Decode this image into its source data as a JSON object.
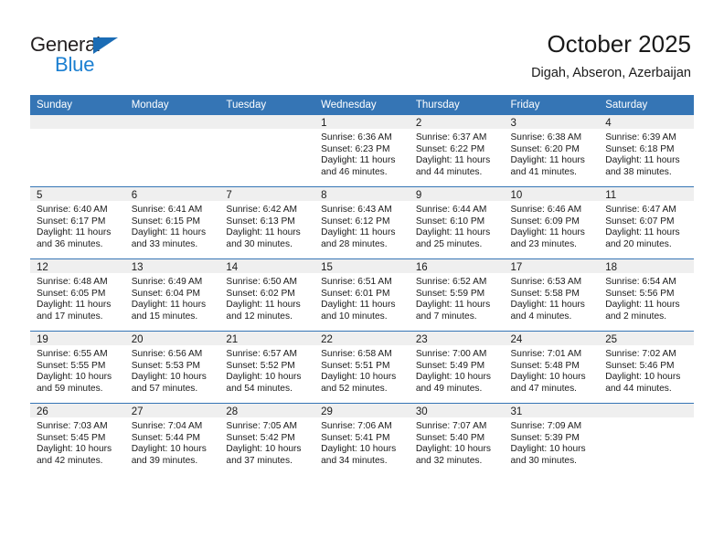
{
  "brand": {
    "name_line1": "General",
    "name_line2": "Blue",
    "triangle_icon": "blue-triangle-icon",
    "color_dark": "#231f20",
    "color_blue": "#1b7fd1",
    "accent": "#3575b5"
  },
  "header": {
    "title": "October 2025",
    "subtitle": "Digah, Abseron, Azerbaijan"
  },
  "weekday_headers": [
    "Sunday",
    "Monday",
    "Tuesday",
    "Wednesday",
    "Thursday",
    "Friday",
    "Saturday"
  ],
  "weeks": [
    [
      {
        "day": "",
        "sunrise": "",
        "sunset": "",
        "daylight_line1": "",
        "daylight_line2": "",
        "empty": true
      },
      {
        "day": "",
        "sunrise": "",
        "sunset": "",
        "daylight_line1": "",
        "daylight_line2": "",
        "empty": true
      },
      {
        "day": "",
        "sunrise": "",
        "sunset": "",
        "daylight_line1": "",
        "daylight_line2": "",
        "empty": true
      },
      {
        "day": "1",
        "sunrise": "Sunrise: 6:36 AM",
        "sunset": "Sunset: 6:23 PM",
        "daylight_line1": "Daylight: 11 hours",
        "daylight_line2": "and 46 minutes.",
        "empty": false
      },
      {
        "day": "2",
        "sunrise": "Sunrise: 6:37 AM",
        "sunset": "Sunset: 6:22 PM",
        "daylight_line1": "Daylight: 11 hours",
        "daylight_line2": "and 44 minutes.",
        "empty": false
      },
      {
        "day": "3",
        "sunrise": "Sunrise: 6:38 AM",
        "sunset": "Sunset: 6:20 PM",
        "daylight_line1": "Daylight: 11 hours",
        "daylight_line2": "and 41 minutes.",
        "empty": false
      },
      {
        "day": "4",
        "sunrise": "Sunrise: 6:39 AM",
        "sunset": "Sunset: 6:18 PM",
        "daylight_line1": "Daylight: 11 hours",
        "daylight_line2": "and 38 minutes.",
        "empty": false
      }
    ],
    [
      {
        "day": "5",
        "sunrise": "Sunrise: 6:40 AM",
        "sunset": "Sunset: 6:17 PM",
        "daylight_line1": "Daylight: 11 hours",
        "daylight_line2": "and 36 minutes.",
        "empty": false
      },
      {
        "day": "6",
        "sunrise": "Sunrise: 6:41 AM",
        "sunset": "Sunset: 6:15 PM",
        "daylight_line1": "Daylight: 11 hours",
        "daylight_line2": "and 33 minutes.",
        "empty": false
      },
      {
        "day": "7",
        "sunrise": "Sunrise: 6:42 AM",
        "sunset": "Sunset: 6:13 PM",
        "daylight_line1": "Daylight: 11 hours",
        "daylight_line2": "and 30 minutes.",
        "empty": false
      },
      {
        "day": "8",
        "sunrise": "Sunrise: 6:43 AM",
        "sunset": "Sunset: 6:12 PM",
        "daylight_line1": "Daylight: 11 hours",
        "daylight_line2": "and 28 minutes.",
        "empty": false
      },
      {
        "day": "9",
        "sunrise": "Sunrise: 6:44 AM",
        "sunset": "Sunset: 6:10 PM",
        "daylight_line1": "Daylight: 11 hours",
        "daylight_line2": "and 25 minutes.",
        "empty": false
      },
      {
        "day": "10",
        "sunrise": "Sunrise: 6:46 AM",
        "sunset": "Sunset: 6:09 PM",
        "daylight_line1": "Daylight: 11 hours",
        "daylight_line2": "and 23 minutes.",
        "empty": false
      },
      {
        "day": "11",
        "sunrise": "Sunrise: 6:47 AM",
        "sunset": "Sunset: 6:07 PM",
        "daylight_line1": "Daylight: 11 hours",
        "daylight_line2": "and 20 minutes.",
        "empty": false
      }
    ],
    [
      {
        "day": "12",
        "sunrise": "Sunrise: 6:48 AM",
        "sunset": "Sunset: 6:05 PM",
        "daylight_line1": "Daylight: 11 hours",
        "daylight_line2": "and 17 minutes.",
        "empty": false
      },
      {
        "day": "13",
        "sunrise": "Sunrise: 6:49 AM",
        "sunset": "Sunset: 6:04 PM",
        "daylight_line1": "Daylight: 11 hours",
        "daylight_line2": "and 15 minutes.",
        "empty": false
      },
      {
        "day": "14",
        "sunrise": "Sunrise: 6:50 AM",
        "sunset": "Sunset: 6:02 PM",
        "daylight_line1": "Daylight: 11 hours",
        "daylight_line2": "and 12 minutes.",
        "empty": false
      },
      {
        "day": "15",
        "sunrise": "Sunrise: 6:51 AM",
        "sunset": "Sunset: 6:01 PM",
        "daylight_line1": "Daylight: 11 hours",
        "daylight_line2": "and 10 minutes.",
        "empty": false
      },
      {
        "day": "16",
        "sunrise": "Sunrise: 6:52 AM",
        "sunset": "Sunset: 5:59 PM",
        "daylight_line1": "Daylight: 11 hours",
        "daylight_line2": "and 7 minutes.",
        "empty": false
      },
      {
        "day": "17",
        "sunrise": "Sunrise: 6:53 AM",
        "sunset": "Sunset: 5:58 PM",
        "daylight_line1": "Daylight: 11 hours",
        "daylight_line2": "and 4 minutes.",
        "empty": false
      },
      {
        "day": "18",
        "sunrise": "Sunrise: 6:54 AM",
        "sunset": "Sunset: 5:56 PM",
        "daylight_line1": "Daylight: 11 hours",
        "daylight_line2": "and 2 minutes.",
        "empty": false
      }
    ],
    [
      {
        "day": "19",
        "sunrise": "Sunrise: 6:55 AM",
        "sunset": "Sunset: 5:55 PM",
        "daylight_line1": "Daylight: 10 hours",
        "daylight_line2": "and 59 minutes.",
        "empty": false
      },
      {
        "day": "20",
        "sunrise": "Sunrise: 6:56 AM",
        "sunset": "Sunset: 5:53 PM",
        "daylight_line1": "Daylight: 10 hours",
        "daylight_line2": "and 57 minutes.",
        "empty": false
      },
      {
        "day": "21",
        "sunrise": "Sunrise: 6:57 AM",
        "sunset": "Sunset: 5:52 PM",
        "daylight_line1": "Daylight: 10 hours",
        "daylight_line2": "and 54 minutes.",
        "empty": false
      },
      {
        "day": "22",
        "sunrise": "Sunrise: 6:58 AM",
        "sunset": "Sunset: 5:51 PM",
        "daylight_line1": "Daylight: 10 hours",
        "daylight_line2": "and 52 minutes.",
        "empty": false
      },
      {
        "day": "23",
        "sunrise": "Sunrise: 7:00 AM",
        "sunset": "Sunset: 5:49 PM",
        "daylight_line1": "Daylight: 10 hours",
        "daylight_line2": "and 49 minutes.",
        "empty": false
      },
      {
        "day": "24",
        "sunrise": "Sunrise: 7:01 AM",
        "sunset": "Sunset: 5:48 PM",
        "daylight_line1": "Daylight: 10 hours",
        "daylight_line2": "and 47 minutes.",
        "empty": false
      },
      {
        "day": "25",
        "sunrise": "Sunrise: 7:02 AM",
        "sunset": "Sunset: 5:46 PM",
        "daylight_line1": "Daylight: 10 hours",
        "daylight_line2": "and 44 minutes.",
        "empty": false
      }
    ],
    [
      {
        "day": "26",
        "sunrise": "Sunrise: 7:03 AM",
        "sunset": "Sunset: 5:45 PM",
        "daylight_line1": "Daylight: 10 hours",
        "daylight_line2": "and 42 minutes.",
        "empty": false
      },
      {
        "day": "27",
        "sunrise": "Sunrise: 7:04 AM",
        "sunset": "Sunset: 5:44 PM",
        "daylight_line1": "Daylight: 10 hours",
        "daylight_line2": "and 39 minutes.",
        "empty": false
      },
      {
        "day": "28",
        "sunrise": "Sunrise: 7:05 AM",
        "sunset": "Sunset: 5:42 PM",
        "daylight_line1": "Daylight: 10 hours",
        "daylight_line2": "and 37 minutes.",
        "empty": false
      },
      {
        "day": "29",
        "sunrise": "Sunrise: 7:06 AM",
        "sunset": "Sunset: 5:41 PM",
        "daylight_line1": "Daylight: 10 hours",
        "daylight_line2": "and 34 minutes.",
        "empty": false
      },
      {
        "day": "30",
        "sunrise": "Sunrise: 7:07 AM",
        "sunset": "Sunset: 5:40 PM",
        "daylight_line1": "Daylight: 10 hours",
        "daylight_line2": "and 32 minutes.",
        "empty": false
      },
      {
        "day": "31",
        "sunrise": "Sunrise: 7:09 AM",
        "sunset": "Sunset: 5:39 PM",
        "daylight_line1": "Daylight: 10 hours",
        "daylight_line2": "and 30 minutes.",
        "empty": false
      },
      {
        "day": "",
        "sunrise": "",
        "sunset": "",
        "daylight_line1": "",
        "daylight_line2": "",
        "empty": true
      }
    ]
  ]
}
